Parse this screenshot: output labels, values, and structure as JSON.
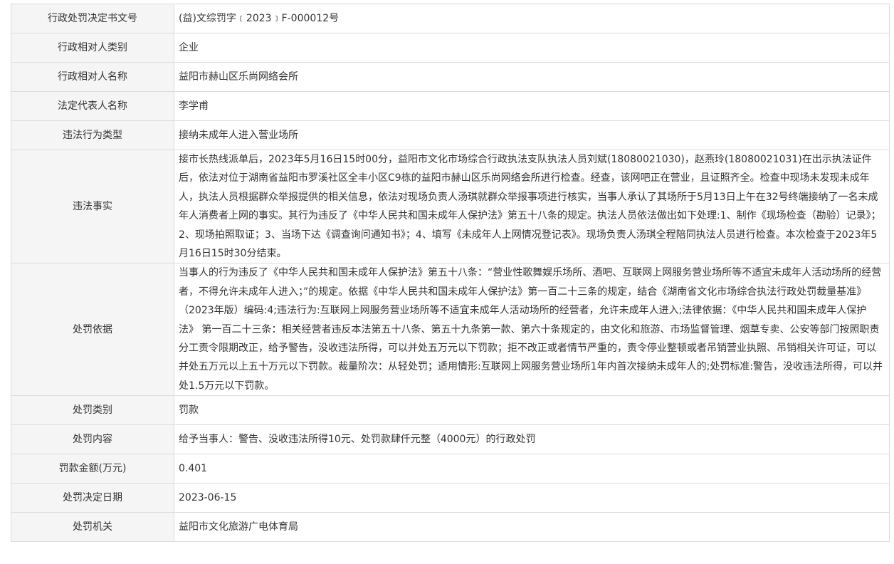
{
  "rows": [
    {
      "label": "行政处罚决定书文号",
      "value": "(益)文综罚字﹝2023﹞F-000012号"
    },
    {
      "label": "行政相对人类别",
      "value": "企业"
    },
    {
      "label": "行政相对人名称",
      "value": "益阳市赫山区乐尚网络会所"
    },
    {
      "label": "法定代表人名称",
      "value": "李学甫"
    },
    {
      "label": "违法行为类型",
      "value": "接纳未成年人进入营业场所"
    },
    {
      "label": "违法事实",
      "value": "接市长热线派单后，2023年5月16日15时00分，益阳市文化市场综合行政执法支队执法人员刘斌(18080021030)，赵燕玲(18080021031)在出示执法证件后，依法对位于湖南省益阳市罗溪社区全丰小区C9栋的益阳市赫山区乐尚网络会所进行检查。经查，该网吧正在营业，且证照齐全。检查中现场未发现未成年人，执法人员根据群众举报提供的相关信息，依法对现场负责人汤琪就群众举报事项进行核实，当事人承认了其场所于5月13日上午在32号终端接纳了一名未成年人消费者上网的事实。其行为违反了《中华人民共和国未成年人保护法》第五十八条的规定。执法人员依法做出如下处理:1、制作《现场检查（勘验）记录》；2、现场拍照取证；3、当场下达《调查询问通知书》；4、填写《未成年人上网情况登记表》。现场负责人汤琪全程陪同执法人员进行检查。本次检查于2023年5月16日15时30分结束。"
    },
    {
      "label": "处罚依据",
      "value": "当事人的行为违反了《中华人民共和国未成年人保护法》第五十八条：“营业性歌舞娱乐场所、酒吧、互联网上网服务营业场所等不适宜未成年人活动场所的经营者，不得允许未成年人进入；”的规定。依据《中华人民共和国未成年人保护法》第一百二十三条的规定，结合《湖南省文化市场综合执法行政处罚裁量基准》（2023年版）编码:4;违法行为:互联网上网服务营业场所等不适宜未成年人活动场所的经营者，允许未成年人进入;法律依据：《中华人民共和国未成年人保护法》 第一百二十三条：相关经营者违反本法第五十八条、第五十九条第一款、第六十条规定的，由文化和旅游、市场监督管理、烟草专卖、公安等部门按照职责分工责令限期改正，给予警告，没收违法所得，可以并处五万元以下罚款；拒不改正或者情节严重的，责令停业整顿或者吊销营业执照、吊销相关许可证，可以并处五万元以上五十万元以下罚款。裁量阶次：从轻处罚；适用情形:互联网上网服务营业场所1年内首次接纳未成年人的;处罚标准:警告，没收违法所得，可以并处1.5万元以下罚款。"
    },
    {
      "label": "处罚类别",
      "value": "罚款"
    },
    {
      "label": "处罚内容",
      "value": "给予当事人：警告、没收违法所得10元、处罚款肆仟元整（4000元）的行政处罚"
    },
    {
      "label": "罚款金额(万元)",
      "value": "0.401"
    },
    {
      "label": "处罚决定日期",
      "value": "2023-06-15"
    },
    {
      "label": "处罚机关",
      "value": "益阳市文化旅游广电体育局"
    }
  ]
}
